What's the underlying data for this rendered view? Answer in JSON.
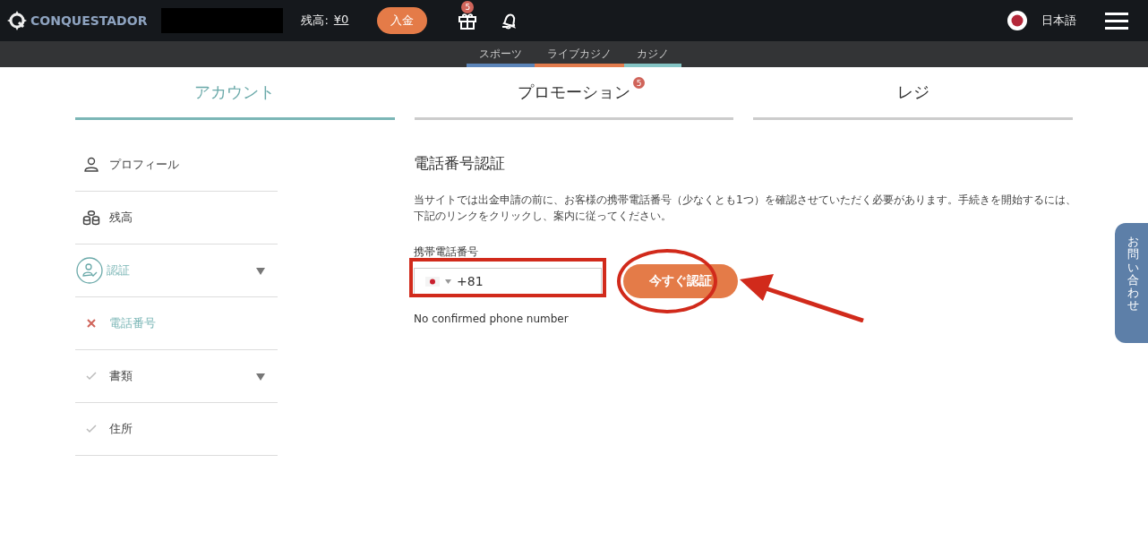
{
  "header": {
    "logo": "CONQUESTADOR",
    "balance_label": "残高:",
    "balance_value": "¥0",
    "deposit_button": "入金",
    "gift_badge": "5",
    "language": "日本語"
  },
  "subnav": [
    {
      "label": "スポーツ",
      "color": "#5b84b8"
    },
    {
      "label": "ライブカジノ",
      "color": "#e27b4c"
    },
    {
      "label": "カジノ",
      "color": "#84c4c4"
    }
  ],
  "tabs": [
    {
      "label": "アカウント",
      "selected": true
    },
    {
      "label": "プロモーション",
      "selected": false,
      "badge": "5"
    },
    {
      "label": "レジ",
      "selected": false
    }
  ],
  "sidebar": {
    "items": [
      {
        "label": "プロフィール",
        "kind": "profile",
        "selected": false,
        "expandable": false
      },
      {
        "label": "残高",
        "kind": "balance",
        "selected": false,
        "expandable": false
      },
      {
        "label": "認証",
        "kind": "verification",
        "selected": true,
        "expandable": true
      },
      {
        "label": "電話番号",
        "kind": "failed",
        "selected": true,
        "expandable": false
      },
      {
        "label": "書類",
        "kind": "done",
        "selected": false,
        "expandable": true
      },
      {
        "label": "住所",
        "kind": "done",
        "selected": false,
        "expandable": false
      }
    ]
  },
  "content": {
    "title": "電話番号認証",
    "description": "当サイトでは出金申請の前に、お客様の携帯電話番号（少なくとも1つ）を確認させていただく必要があります。手続きを開始するには、下記のリンクをクリックし、案内に従ってください。",
    "phone_label": "携帯電話番号",
    "phone_value": "+81",
    "verify_button": "今すぐ認証",
    "status": "No confirmed phone number"
  },
  "contact_tab": "お問い合わせ"
}
